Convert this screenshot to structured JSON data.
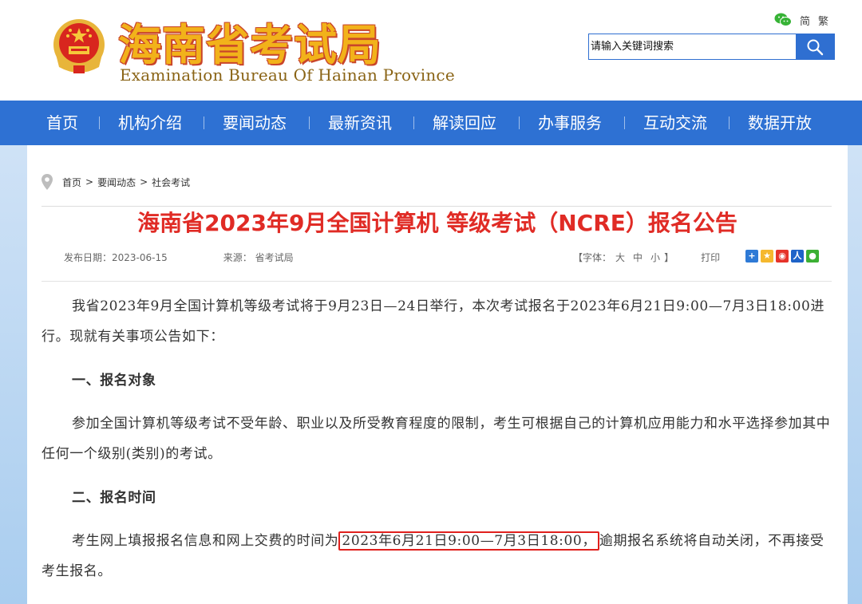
{
  "header": {
    "site_title": "海南省考试局",
    "site_subtitle": "Examination Bureau Of Hainan Province",
    "lang_simplified": "简",
    "lang_traditional": "繁",
    "search_placeholder": "请输入关键词搜索"
  },
  "nav": {
    "items": [
      "首页",
      "机构介绍",
      "要闻动态",
      "最新资讯",
      "解读回应",
      "办事服务",
      "互动交流",
      "数据开放"
    ]
  },
  "breadcrumb": {
    "items": [
      "首页",
      "要闻动态",
      "社会考试"
    ],
    "separator": ">"
  },
  "article": {
    "title": "海南省2023年9月全国计算机 等级考试（NCRE）报名公告",
    "date_label": "发布日期：",
    "date": "2023-06-15",
    "source_label": "来源：",
    "source": "省考试局",
    "font_size_label_open": "【字体：",
    "font_large": "大",
    "font_medium": "中",
    "font_small": "小",
    "font_size_label_close": "】",
    "print_label": "打印",
    "paragraph1": "我省2023年9月全国计算机等级考试将于9月23日—24日举行，本次考试报名于2023年6月21日9:00—7月3日18:00进行。现就有关事项公告如下：",
    "heading1": "一、报名对象",
    "paragraph2": "参加全国计算机等级考试不受年龄、职业以及所受教育程度的限制，考生可根据自己的计算机应用能力和水平选择参加其中任何一个级别(类别)的考试。",
    "heading2": "二、报名时间",
    "paragraph3_before": "考生网上填报报名信息和网上交费的时间为",
    "paragraph3_highlight": "2023年6月21日9:00—7月3日18:00，",
    "paragraph3_after": "逾期报名系统将自动关闭，不再接受考生报名。"
  },
  "colors": {
    "nav_bg": "#2e71d3",
    "title_red": "#e02b25",
    "highlight_border": "#e0201d",
    "logo_gold": "#f2b21a"
  },
  "icons": [
    "national-emblem-icon",
    "wechat-icon",
    "search-icon",
    "location-pin-icon",
    "share-plus-icon",
    "share-qzone-icon",
    "share-weibo-icon",
    "share-renren-icon",
    "share-wechat-icon"
  ]
}
